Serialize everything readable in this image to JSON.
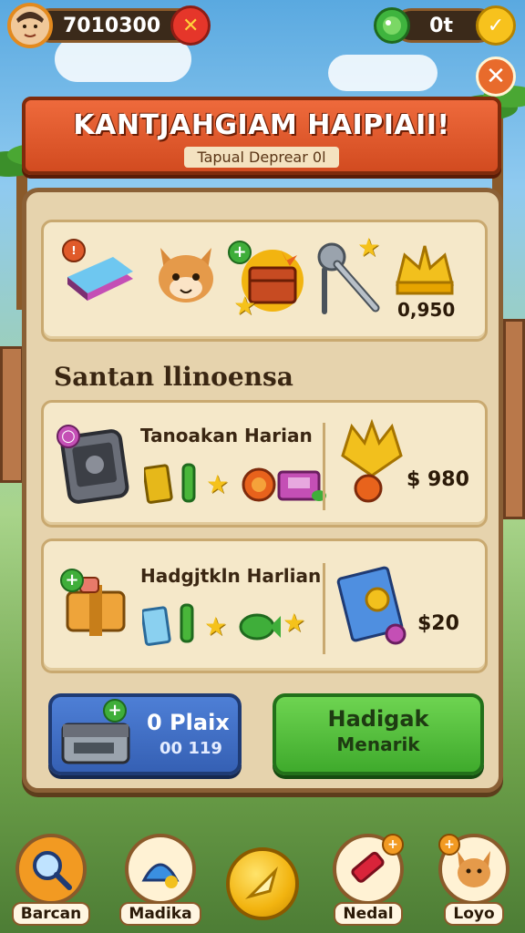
{
  "hud": {
    "player_score": "7010300",
    "right_value": "0t"
  },
  "banner": {
    "title": "KANTJAHGIAM HAIPIAII!",
    "subtitle": "Tapual Deprear 0l"
  },
  "reward_row": {
    "price": "0,950"
  },
  "section": {
    "title": "Santan llinoensa"
  },
  "tasks": [
    {
      "label": "Tanoakan Harian",
      "price": "$ 980"
    },
    {
      "label": "Hadgjtkln Harlian",
      "price": "$20"
    }
  ],
  "buttons": {
    "blue_line1": "0 Plaix",
    "blue_line2": "00 119",
    "green_line1": "Hadigak",
    "green_line2": "Menarik"
  },
  "nav": [
    {
      "label": "Barcan"
    },
    {
      "label": "Madika"
    },
    {
      "label": "Nedal"
    },
    {
      "label": "Loyo"
    }
  ],
  "colors": {
    "banner": "#d24b20",
    "panel": "#e6d3ad",
    "green_button": "#3faa2c",
    "blue_button": "#3560b4"
  }
}
